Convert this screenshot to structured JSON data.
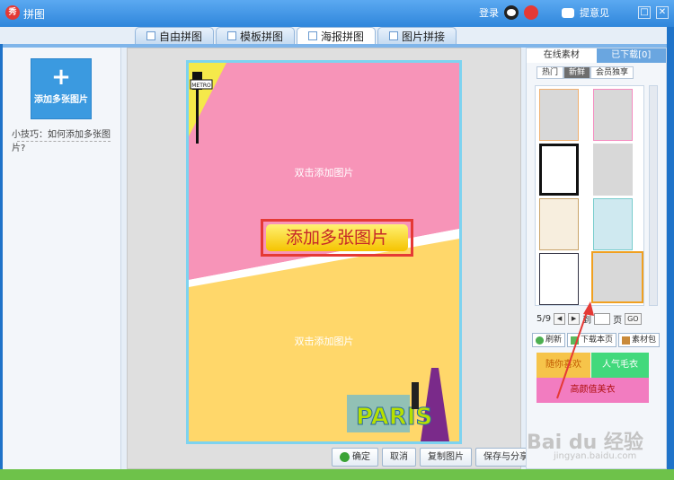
{
  "window": {
    "title": "拼图",
    "logo_text": "秀"
  },
  "titlebar": {
    "login": "登录",
    "feedback": "提意见",
    "minimize": "□",
    "close": "✕"
  },
  "tabs": [
    {
      "label": "自由拼图",
      "active": false
    },
    {
      "label": "模板拼图",
      "active": false
    },
    {
      "label": "海报拼图",
      "active": true
    },
    {
      "label": "图片拼接",
      "active": false
    }
  ],
  "left": {
    "add_plus": "+",
    "add_label": "添加多张图片",
    "tip": "小技巧：如何添加多张图片?"
  },
  "poster": {
    "placeholder_top": "双击添加图片",
    "placeholder_bottom": "双击添加图片",
    "add_multi": "添加多张图片",
    "sign_text": "METRO",
    "paris_text": "PARIS"
  },
  "bottom_buttons": {
    "confirm": "确定",
    "cancel": "取消",
    "copy": "复制图片",
    "save_share": "保存与分享"
  },
  "right": {
    "tabs": [
      {
        "label": "在线素材",
        "active": true
      },
      {
        "label": "已下载[0]",
        "active": false
      }
    ],
    "subtabs": [
      {
        "label": "热门",
        "active": false
      },
      {
        "label": "新鲜",
        "active": true
      },
      {
        "label": "会员独享",
        "active": false
      }
    ],
    "pager": {
      "current": "5/9",
      "prev": "◀",
      "next": "▶",
      "to": "到",
      "page": "页",
      "go": "GO"
    },
    "actions": {
      "refresh": "刷新",
      "download_page": "下载本页",
      "package": "素材包"
    },
    "banners": {
      "b1": "随你喜欢",
      "b2": "人气毛衣",
      "b3": "高颜值美衣"
    }
  },
  "watermark": {
    "logo": "Bai du 经验",
    "url": "jingyan.baidu.com"
  },
  "colors": {
    "accent_blue": "#3b9ae0",
    "poster_pink": "#f794b8",
    "poster_yellow": "#ffd76a",
    "highlight_red": "#e53935"
  }
}
